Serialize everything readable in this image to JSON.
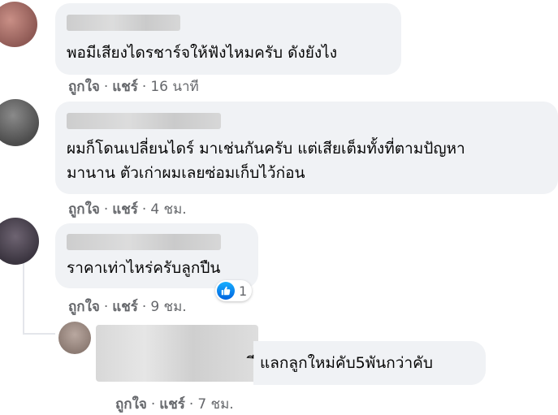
{
  "comments": [
    {
      "text": [
        "พอมีเสียงไดรชาร์จให้ฟังไหมครับ ดังยังไง"
      ],
      "like": "ถูกใจ",
      "share": "แชร์",
      "sep": "·",
      "time": "16 นาที"
    },
    {
      "text": [
        "ผมก็โดนเปลี่ยนไดร์ มาเช่นกันครับ แต่เสียเต็มทั้งที่ตามปัญหา",
        "มานาน ตัวเก่าผมเลยซ่อมเก็บไว้ก่อน"
      ],
      "like": "ถูกใจ",
      "share": "แชร์",
      "sep": "·",
      "time": "4 ชม."
    },
    {
      "text": [
        "ราคาเท่าไหร่ครับลูกปืน"
      ],
      "like": "ถูกใจ",
      "share": "แชร์",
      "sep": "·",
      "time": "9 ชม.",
      "reaction_count": "1"
    },
    {
      "text": [
        "ี แลกลูกใหม่คับ5พันกว่าคับ"
      ],
      "like": "ถูกใจ",
      "share": "แชร์",
      "sep": "·",
      "time": "7 ชม."
    }
  ],
  "colors": {
    "bubble": "#f0f2f5",
    "meta": "#65676b",
    "like_blue": "#1877f2"
  },
  "icons": {
    "reaction": "like-thumbs-up-icon"
  }
}
